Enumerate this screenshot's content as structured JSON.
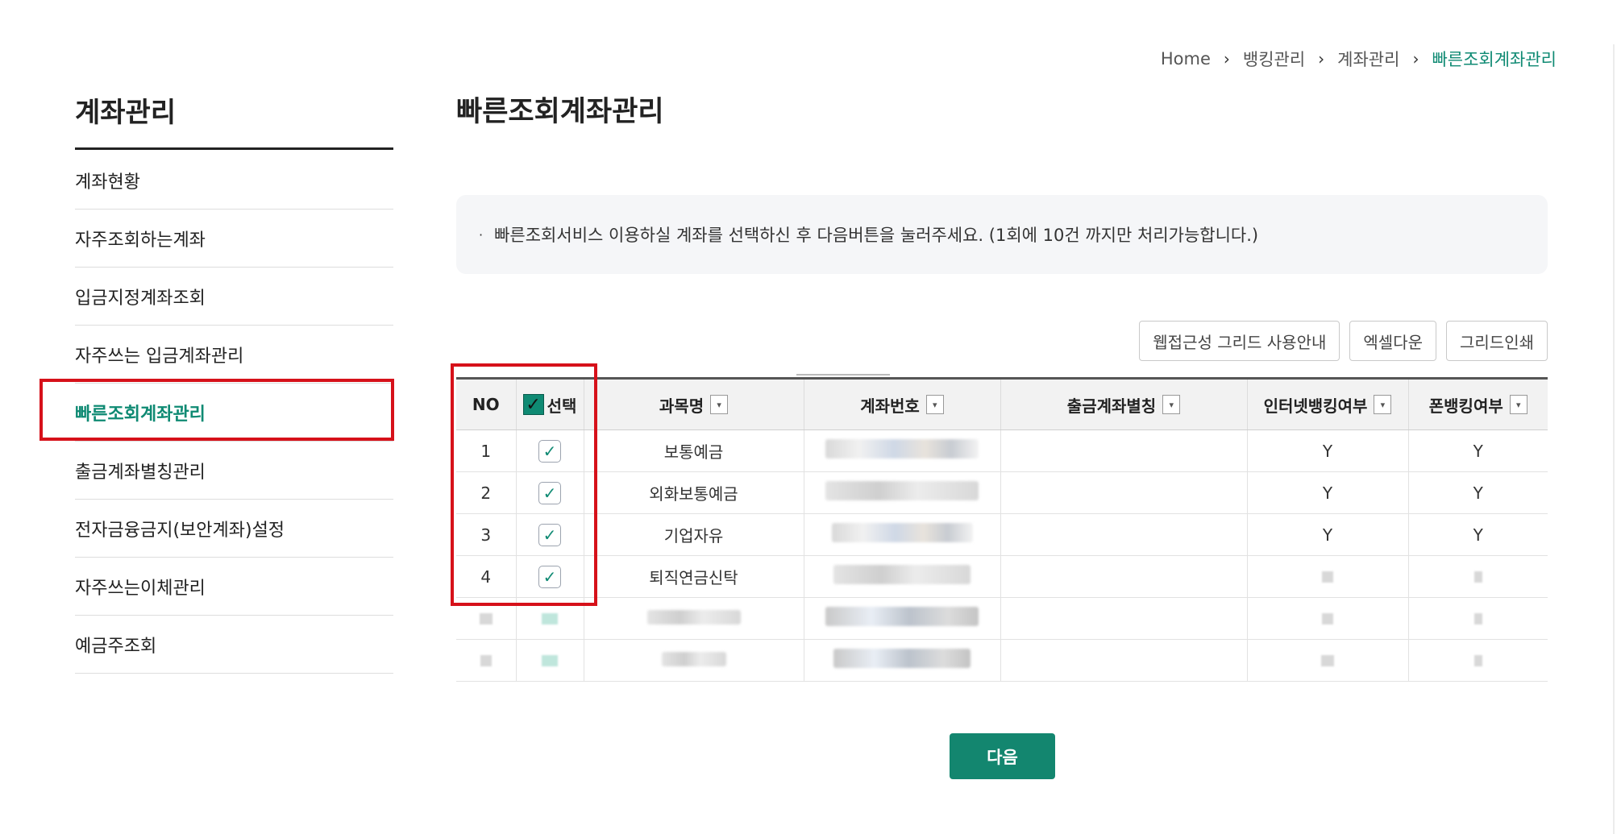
{
  "breadcrumb": {
    "items": [
      "Home",
      "뱅킹관리",
      "계좌관리"
    ],
    "current": "빠른조회계좌관리"
  },
  "sidebar": {
    "title": "계좌관리",
    "items": [
      {
        "label": "계좌현황"
      },
      {
        "label": "자주조회하는계좌"
      },
      {
        "label": "입금지정계좌조회"
      },
      {
        "label": "자주쓰는 입금계좌관리"
      },
      {
        "label": "빠른조회계좌관리",
        "active": true
      },
      {
        "label": "출금계좌별칭관리"
      },
      {
        "label": "전자금융금지(보안계좌)설정"
      },
      {
        "label": "자주쓰는이체관리"
      },
      {
        "label": "예금주조회"
      }
    ]
  },
  "main": {
    "title": "빠른조회계좌관리",
    "notice_bullet": "·",
    "notice": "빠른조회서비스 이용하실 계좌를 선택하신 후 다음버튼을 눌러주세요. (1회에 10건 까지만 처리가능합니다.)",
    "buttons": {
      "accessibility": "웹접근성 그리드 사용안내",
      "excel": "엑셀다운",
      "print": "그리드인쇄"
    },
    "next_button": "다음"
  },
  "grid": {
    "columns": {
      "no": "NO",
      "select": "선택",
      "subject": "과목명",
      "account": "계좌번호",
      "alias": "출금계좌별칭",
      "internet": "인터넷뱅킹여부",
      "phone": "폰뱅킹여부"
    },
    "header_check_glyph": "✓",
    "row_check_glyph": "✓",
    "filter_glyph": "▾",
    "rows": [
      {
        "no": "1",
        "subject": "보통예금",
        "internet": "Y",
        "phone": "Y",
        "checked": true
      },
      {
        "no": "2",
        "subject": "외화보통예금",
        "internet": "Y",
        "phone": "Y",
        "checked": true
      },
      {
        "no": "3",
        "subject": "기업자유",
        "internet": "Y",
        "phone": "Y",
        "checked": true
      },
      {
        "no": "4",
        "subject": "퇴직연금신탁",
        "internet": "",
        "phone": "",
        "checked": true
      },
      {
        "no": "",
        "subject": "",
        "internet": "",
        "phone": "",
        "checked": false,
        "obscured": true
      },
      {
        "no": "",
        "subject": "",
        "internet": "",
        "phone": "",
        "checked": false,
        "obscured": true
      }
    ]
  },
  "colors": {
    "accent": "#13866f",
    "highlight": "#d6111a"
  }
}
